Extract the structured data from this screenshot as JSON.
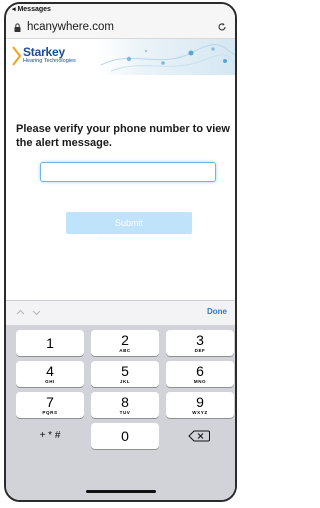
{
  "status_bar": {
    "back_label": "◂ Messages"
  },
  "browser": {
    "url": "hcanywhere.com",
    "lock_icon": "lock-icon",
    "reload_icon": "reload-icon"
  },
  "banner": {
    "brand_name": "Starkey",
    "brand_subtitle": "Hearing Technologies"
  },
  "form": {
    "prompt": "Please verify your phone number to view the alert message.",
    "phone_value": "",
    "phone_placeholder": "",
    "submit_label": "Submit"
  },
  "keyboard_toolbar": {
    "prev_icon": "chevron-up-icon",
    "next_icon": "chevron-down-icon",
    "done_label": "Done"
  },
  "keypad": {
    "keys": [
      {
        "digit": "1",
        "letters": ""
      },
      {
        "digit": "2",
        "letters": "ABC"
      },
      {
        "digit": "3",
        "letters": "DEF"
      },
      {
        "digit": "4",
        "letters": "GHI"
      },
      {
        "digit": "5",
        "letters": "JKL"
      },
      {
        "digit": "6",
        "letters": "MNO"
      },
      {
        "digit": "7",
        "letters": "PQRS"
      },
      {
        "digit": "8",
        "letters": "TUV"
      },
      {
        "digit": "9",
        "letters": "WXYZ"
      },
      {
        "digit": "0",
        "letters": ""
      }
    ],
    "symbols_label": "+ * #",
    "delete_icon": "backspace-icon"
  },
  "colors": {
    "brand": "#1d4f8a",
    "accent": "#2a7bd8",
    "submit_bg": "#bfe3f8",
    "input_border": "#6fb6e6",
    "keyboard_bg": "#d1d3d9"
  }
}
